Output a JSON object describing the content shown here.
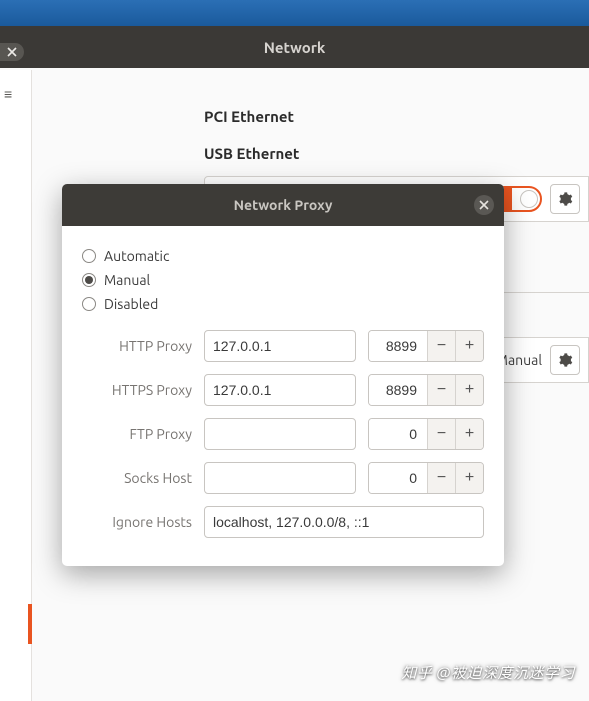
{
  "window": {
    "title": "Network"
  },
  "sections": {
    "pci": "PCI Ethernet",
    "usb": "USB Ethernet",
    "status_manual": "Manual"
  },
  "dialog": {
    "title": "Network Proxy",
    "mode_options": {
      "automatic": "Automatic",
      "manual": "Manual",
      "disabled": "Disabled"
    },
    "selected_mode": "manual",
    "rows": {
      "http": {
        "label": "HTTP Proxy",
        "host": "127.0.0.1",
        "port": "8899"
      },
      "https": {
        "label": "HTTPS Proxy",
        "host": "127.0.0.1",
        "port": "8899"
      },
      "ftp": {
        "label": "FTP Proxy",
        "host": "",
        "port": "0"
      },
      "socks": {
        "label": "Socks Host",
        "host": "",
        "port": "0"
      },
      "ignore": {
        "label": "Ignore Hosts",
        "value": "localhost, 127.0.0.0/8, ::1"
      }
    }
  },
  "watermark": "知乎 @被迫深度沉迷学习"
}
